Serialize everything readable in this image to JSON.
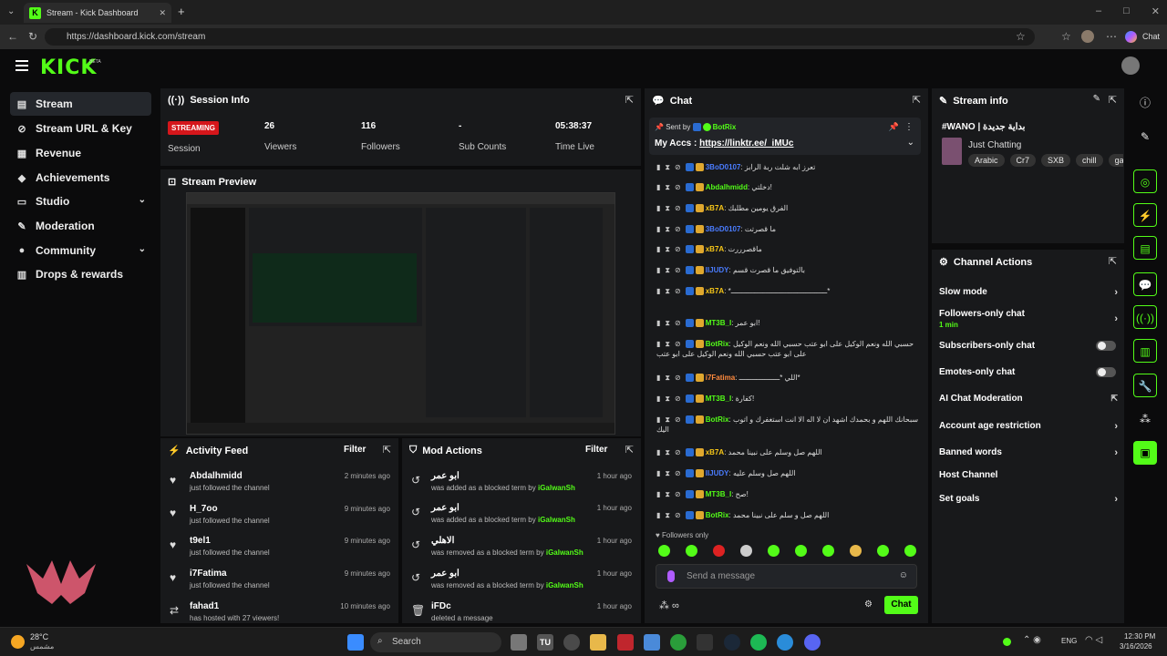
{
  "browser": {
    "tab_title": "Stream - Kick Dashboard",
    "url": "https://dashboard.kick.com/stream",
    "chat_label": "Chat"
  },
  "app": {
    "logo": "KICK",
    "beta": "BETA"
  },
  "sidebar": {
    "items": [
      {
        "label": "Stream"
      },
      {
        "label": "Stream URL & Key"
      },
      {
        "label": "Revenue"
      },
      {
        "label": "Achievements"
      },
      {
        "label": "Studio"
      },
      {
        "label": "Moderation"
      },
      {
        "label": "Community"
      },
      {
        "label": "Drops & rewards"
      }
    ]
  },
  "session": {
    "title": "Session Info",
    "status": "STREAMING",
    "status_label": "Session",
    "viewers": "26",
    "viewers_label": "Viewers",
    "followers": "116",
    "followers_label": "Followers",
    "subs": "-",
    "subs_label": "Sub Counts",
    "time": "05:38:37",
    "time_label": "Time Live"
  },
  "preview": {
    "title": "Stream Preview"
  },
  "activity": {
    "title": "Activity Feed",
    "filter": "Filter",
    "items": [
      {
        "name": "Abdalhmidd",
        "sub": "just followed the channel",
        "time": "2 minutes ago"
      },
      {
        "name": "H_7oo",
        "sub": "just followed the channel",
        "time": "9 minutes ago"
      },
      {
        "name": "t9el1",
        "sub": "just followed the channel",
        "time": "9 minutes ago"
      },
      {
        "name": "i7Fatima",
        "sub": "just followed the channel",
        "time": "9 minutes ago"
      },
      {
        "name": "fahad1",
        "sub": "has hosted with 27 viewers!",
        "time": "10 minutes ago"
      }
    ]
  },
  "mod": {
    "title": "Mod Actions",
    "filter": "Filter",
    "items": [
      {
        "name": "ابو عمر",
        "sub": "was added as a blocked term by",
        "by": "iGalwanSh",
        "time": "1 hour ago"
      },
      {
        "name": "ابو عمر",
        "sub": "was added as a blocked term by",
        "by": "iGalwanSh",
        "time": "1 hour ago"
      },
      {
        "name": "الاهلي",
        "sub": "was removed as a blocked term by",
        "by": "iGalwanSh",
        "time": "1 hour ago"
      },
      {
        "name": "ابو عمر",
        "sub": "was removed as a blocked term by",
        "by": "iGalwanSh",
        "time": "1 hour ago"
      },
      {
        "name": "iFDc",
        "sub": "deleted a message",
        "by": "",
        "time": "1 hour ago"
      }
    ]
  },
  "chat": {
    "title": "Chat",
    "pinned_by": "Sent by",
    "pinned_user": "BotRix",
    "pinned_text": "My Accs : ",
    "pinned_link": "https://linktr.ee/_iMUc",
    "followers_only": "Followers only",
    "placeholder": "Send a message",
    "send": "Chat",
    "messages": [
      {
        "user": "3BoD0107",
        "color": "#4a7cff",
        "text": "تعرز ابه شلت ربة الرابز"
      },
      {
        "user": "Abdalhmidd",
        "color": "#53fc18",
        "text": "دخلتي!"
      },
      {
        "user": "xB7A",
        "color": "#f5c518",
        "text": "الفرق يومين مطلبك"
      },
      {
        "user": "3BoD0107",
        "color": "#4a7cff",
        "text": "ما قصرتت"
      },
      {
        "user": "xB7A",
        "color": "#f5c518",
        "text": "ماقصرررت"
      },
      {
        "user": "IIJUDY",
        "color": "#4a7cff",
        "text": "بالتوفيق ما قصرت قسم"
      },
      {
        "user": "xB7A",
        "color": "#f5c518",
        "text": "*ـــــــــــــــــــــــــــــــــــــــــــــ*"
      },
      {
        "user": "MT3B_I",
        "color": "#53fc18",
        "text": "ابو عمر!"
      },
      {
        "user": "BotRix",
        "color": "#53fc18",
        "text": "حسبي الله ونعم الوكيل على ابو عتب حسبي الله ونعم الوكيل على ابو عتب حسبي الله ونعم الوكيل على ابو عتب"
      },
      {
        "user": "i7Fatima",
        "color": "#ff8a3d",
        "text": "اللي *ـــــــــــــــــــ*"
      },
      {
        "user": "MT3B_I",
        "color": "#53fc18",
        "text": "كفارة!"
      },
      {
        "user": "BotRix",
        "color": "#53fc18",
        "text": "سبحانك اللهم و بحمدك اشهد ان لا اله الا انت استغفرك و اتوب اليك"
      },
      {
        "user": "xB7A",
        "color": "#f5c518",
        "text": "اللهم صل وسلم على نبينا محمد"
      },
      {
        "user": "IIJUDY",
        "color": "#4a7cff",
        "text": "اللهم صل وسلم عليه"
      },
      {
        "user": "MT3B_I",
        "color": "#53fc18",
        "text": "صح!"
      },
      {
        "user": "BotRix",
        "color": "#53fc18",
        "text": "اللهم صل و سلم على نبينا محمد"
      }
    ]
  },
  "stream_info": {
    "title": "Stream info",
    "stream_title": "#WANO | بداية جديدة",
    "category": "Just Chatting",
    "tags": [
      "Arabic",
      "Cr7",
      "SXB",
      "chill",
      "ga"
    ]
  },
  "channel_actions": {
    "title": "Channel Actions",
    "items": [
      {
        "label": "Slow mode",
        "sub": ""
      },
      {
        "label": "Followers-only chat",
        "sub": "1 min"
      },
      {
        "label": "Subscribers-only chat",
        "sub": ""
      },
      {
        "label": "Emotes-only chat",
        "sub": ""
      },
      {
        "label": "AI Chat Moderation",
        "sub": ""
      },
      {
        "label": "Account age restriction",
        "sub": ""
      },
      {
        "label": "Banned words",
        "sub": ""
      },
      {
        "label": "Host Channel",
        "sub": ""
      },
      {
        "label": "Set goals",
        "sub": ""
      }
    ]
  },
  "taskbar": {
    "temp": "28°C",
    "weather": "مشمس",
    "search": "Search",
    "lang": "ENG",
    "time": "12:30 PM",
    "date": "3/16/2026"
  }
}
